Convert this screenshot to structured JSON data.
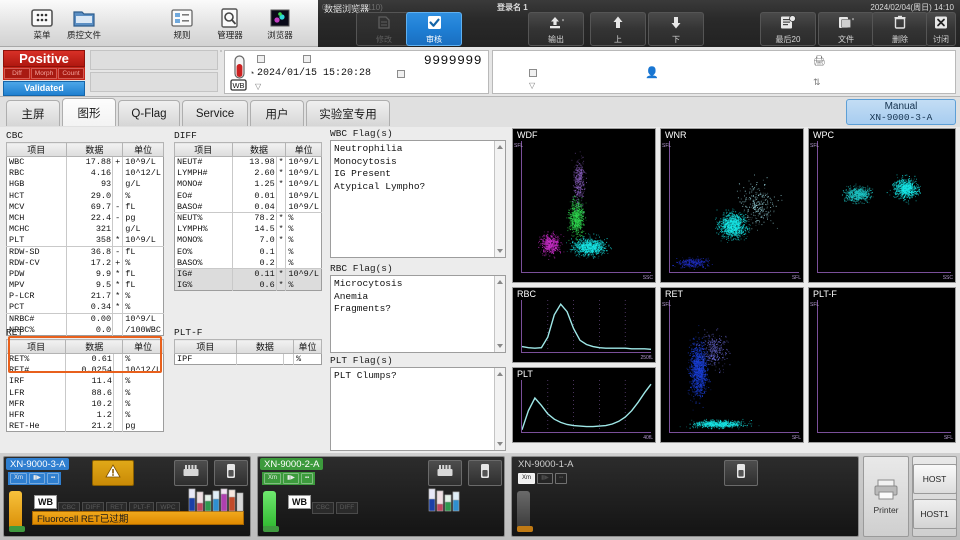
{
  "toolbar": {
    "items": [
      {
        "label": "菜单",
        "icon": "menu-grid-icon"
      },
      {
        "label": "质控文件",
        "icon": "qc-file-icon"
      },
      {
        "label": "规则",
        "icon": "rules-icon"
      },
      {
        "label": "管理器",
        "icon": "manager-icon"
      },
      {
        "label": "浏览器",
        "icon": "browser-icon"
      }
    ],
    "window_title": "数据浏览器",
    "dark_buttons": [
      {
        "label": "修改",
        "icon": "edit-icon",
        "state": "disabled"
      },
      {
        "label": "审核",
        "icon": "check-icon",
        "state": "active"
      },
      {
        "label": "输出",
        "icon": "output-icon",
        "state": "normal"
      },
      {
        "label": "上",
        "icon": "arrow-up-icon",
        "state": "normal"
      },
      {
        "label": "下",
        "icon": "arrow-down-icon",
        "state": "normal"
      },
      {
        "label": "最后20",
        "icon": "last20-icon",
        "state": "normal"
      },
      {
        "label": "文件",
        "icon": "file-icon",
        "state": "normal"
      },
      {
        "label": "删除",
        "icon": "trash-icon",
        "state": "normal"
      },
      {
        "label": "讨闭",
        "icon": "close-x-icon",
        "state": "normal"
      }
    ]
  },
  "status": {
    "left": "00-22 (Build 110)",
    "user": "登录名 1",
    "datetime": "2024/02/04(周日) 14:10"
  },
  "sample": {
    "positive_label": "Positive",
    "positive_tags": [
      "Diff",
      "Morph",
      "Count"
    ],
    "validated_label": "Validated",
    "sample_id": "9999999",
    "datetime": "2024/01/15  15:20:28",
    "tube_label": "WB"
  },
  "tabs": [
    {
      "label": "主屏",
      "selected": false
    },
    {
      "label": "图形",
      "selected": true
    },
    {
      "label": "Q-Flag",
      "selected": false
    },
    {
      "label": "Service",
      "selected": false
    },
    {
      "label": "用户",
      "selected": false
    },
    {
      "label": "实验室专用",
      "selected": false
    }
  ],
  "manual": {
    "line1": "Manual",
    "line2": "XN-9000-3-A"
  },
  "tables": {
    "headers": {
      "item": "项目",
      "data": "数据",
      "unit": "单位"
    },
    "cbc": {
      "title": "CBC",
      "rows": [
        {
          "name": "WBC",
          "value": "17.88",
          "flag": "+",
          "unit": "10^9/L"
        },
        {
          "name": "RBC",
          "value": "4.16",
          "flag": "",
          "unit": "10^12/L"
        },
        {
          "name": "HGB",
          "value": "93",
          "flag": "",
          "unit": "g/L"
        },
        {
          "name": "HCT",
          "value": "29.0",
          "flag": "",
          "unit": "%"
        },
        {
          "name": "MCV",
          "value": "69.7",
          "flag": "-",
          "unit": "fL"
        },
        {
          "name": "MCH",
          "value": "22.4",
          "flag": "-",
          "unit": "pg"
        },
        {
          "name": "MCHC",
          "value": "321",
          "flag": "",
          "unit": "g/L"
        },
        {
          "name": "PLT",
          "value": "358",
          "flag": "*",
          "unit": "10^9/L",
          "groupend": true
        },
        {
          "name": "RDW-SD",
          "value": "36.8",
          "flag": "-",
          "unit": "fL"
        },
        {
          "name": "RDW-CV",
          "value": "17.2",
          "flag": "+",
          "unit": "%"
        },
        {
          "name": "PDW",
          "value": "9.9",
          "flag": "*",
          "unit": "fL"
        },
        {
          "name": "MPV",
          "value": "9.5",
          "flag": "*",
          "unit": "fL"
        },
        {
          "name": "P-LCR",
          "value": "21.7",
          "flag": "*",
          "unit": "%"
        },
        {
          "name": "PCT",
          "value": "0.34",
          "flag": "*",
          "unit": "%",
          "groupend": true
        },
        {
          "name": "NRBC#",
          "value": "0.00",
          "flag": "",
          "unit": "10^9/L"
        },
        {
          "name": "NRBC%",
          "value": "0.0",
          "flag": "",
          "unit": "/100WBC"
        }
      ]
    },
    "ret": {
      "title": "RET",
      "rows": [
        {
          "name": "RET%",
          "value": "0.61",
          "flag": "",
          "unit": "%"
        },
        {
          "name": "RET#",
          "value": "0.0254",
          "flag": "",
          "unit": "10^12/L"
        },
        {
          "name": "IRF",
          "value": "11.4",
          "flag": "",
          "unit": "%"
        },
        {
          "name": "LFR",
          "value": "88.6",
          "flag": "",
          "unit": "%"
        },
        {
          "name": "MFR",
          "value": "10.2",
          "flag": "",
          "unit": "%"
        },
        {
          "name": "HFR",
          "value": "1.2",
          "flag": "",
          "unit": "%"
        },
        {
          "name": "RET-He",
          "value": "21.2",
          "flag": "",
          "unit": "pg"
        }
      ]
    },
    "diff": {
      "title": "DIFF",
      "rows": [
        {
          "name": "NEUT#",
          "value": "13.98",
          "flag": "*",
          "unit": "10^9/L"
        },
        {
          "name": "LYMPH#",
          "value": "2.60",
          "flag": "*",
          "unit": "10^9/L"
        },
        {
          "name": "MONO#",
          "value": "1.25",
          "flag": "*",
          "unit": "10^9/L"
        },
        {
          "name": "EO#",
          "value": "0.01",
          "flag": "",
          "unit": "10^9/L"
        },
        {
          "name": "BASO#",
          "value": "0.04",
          "flag": "",
          "unit": "10^9/L",
          "groupend": true
        },
        {
          "name": "NEUT%",
          "value": "78.2",
          "flag": "*",
          "unit": "%"
        },
        {
          "name": "LYMPH%",
          "value": "14.5",
          "flag": "*",
          "unit": "%"
        },
        {
          "name": "MONO%",
          "value": "7.0",
          "flag": "*",
          "unit": "%"
        },
        {
          "name": "EO%",
          "value": "0.1",
          "flag": "",
          "unit": "%"
        },
        {
          "name": "BASO%",
          "value": "0.2",
          "flag": "",
          "unit": "%",
          "groupend": true
        },
        {
          "name": "IG#",
          "value": "0.11",
          "flag": "*",
          "unit": "10^9/L",
          "shade": true
        },
        {
          "name": "IG%",
          "value": "0.6",
          "flag": "*",
          "unit": "%",
          "shade": true
        }
      ]
    },
    "pltf": {
      "title": "PLT-F",
      "rows": [
        {
          "name": "IPF",
          "value": "",
          "flag": "",
          "unit": "%"
        }
      ]
    }
  },
  "flags": {
    "wbc": {
      "title": "WBC Flag(s)",
      "items": [
        "Neutrophilia",
        "Monocytosis",
        "IG Present",
        "Atypical Lympho?"
      ]
    },
    "rbc": {
      "title": "RBC Flag(s)",
      "items": [
        "Microcytosis",
        "Anemia",
        "Fragments?"
      ]
    },
    "plt": {
      "title": "PLT Flag(s)",
      "items": [
        "PLT Clumps?"
      ]
    }
  },
  "graphs": [
    {
      "title": "WDF",
      "ylabel": "SFL",
      "xlabel": "SSC",
      "type": "scatter"
    },
    {
      "title": "WNR",
      "ylabel": "SFL",
      "xlabel": "SFL",
      "type": "scatter"
    },
    {
      "title": "WPC",
      "ylabel": "SFL",
      "xlabel": "SSC",
      "type": "scatter"
    },
    {
      "title": "RBC",
      "ylabel": "",
      "xlabel": "250fL",
      "type": "histogram"
    },
    {
      "title": "PLT",
      "ylabel": "",
      "xlabel": "40fL",
      "type": "histogram"
    },
    {
      "title": "RET",
      "ylabel": "SFL",
      "xlabel": "SFL",
      "type": "scatter"
    },
    {
      "title": "PLT-F",
      "ylabel": "SFL",
      "xlabel": "SFL",
      "type": "scatter"
    }
  ],
  "analyzers": [
    {
      "name": "XN-9000-3-A",
      "name_color": "#2f7fd0",
      "chips": [
        "Xm",
        "▮▶",
        "▪▪"
      ],
      "tube_color": "#f0a81c",
      "led_color": "#3f9a3f",
      "wb_label": "WB",
      "tests": [
        "CBC",
        "DIFF",
        "RET",
        "PLT-F",
        "WPC"
      ],
      "error": "Fluorocell RET已过期",
      "warning": true,
      "rack_icon": true,
      "tube_icon": true
    },
    {
      "name": "XN-9000-2-A",
      "name_color": "#3c9a3c",
      "chips": [
        "Xm",
        "▮▶",
        "▪▪"
      ],
      "tube_color": "#4fd04f",
      "led_color": "#3f9a3f",
      "wb_label": "WB",
      "tests": [
        "CBC",
        "DIFF"
      ],
      "error": "",
      "warning": false,
      "rack_icon": true,
      "tube_icon": true
    },
    {
      "name": "XN-9000-1-A",
      "name_color": "#555555",
      "chips": [
        "Xm",
        "▮▶",
        "▪▪"
      ],
      "tube_color": "#5a5a5a",
      "led_color": "#c07a14",
      "wb_label": "",
      "tests": [],
      "error": "",
      "warning": false,
      "rack_icon": false,
      "tube_icon": true
    }
  ],
  "right_panels": {
    "printer": "Printer",
    "host": "HOST",
    "host1": "HOST1"
  },
  "chart_data": [
    {
      "type": "scatter",
      "title": "WDF",
      "xlabel": "SSC",
      "ylabel": "SFL",
      "clusters": [
        {
          "name": "lymphocytes",
          "color": "#18e8e8",
          "cx": 0.52,
          "cy": 0.8,
          "rx": 0.13,
          "ry": 0.07,
          "n": 900
        },
        {
          "name": "monocytes",
          "color": "#cf2fcf",
          "cx": 0.22,
          "cy": 0.78,
          "rx": 0.08,
          "ry": 0.08,
          "n": 500
        },
        {
          "name": "neutrophils",
          "color": "#2fd84f",
          "cx": 0.42,
          "cy": 0.58,
          "rx": 0.06,
          "ry": 0.14,
          "n": 700
        },
        {
          "name": "immature",
          "color": "#8a5fbf",
          "cx": 0.44,
          "cy": 0.3,
          "rx": 0.05,
          "ry": 0.18,
          "n": 350
        }
      ]
    },
    {
      "type": "scatter",
      "title": "WNR",
      "xlabel": "SFL",
      "ylabel": "SFL",
      "clusters": [
        {
          "name": "wbc",
          "color": "#18e8e8",
          "cx": 0.48,
          "cy": 0.64,
          "rx": 0.11,
          "ry": 0.1,
          "n": 1100
        },
        {
          "name": "scatter-tail",
          "color": "#9fdfe8",
          "cx": 0.68,
          "cy": 0.48,
          "rx": 0.15,
          "ry": 0.18,
          "n": 260
        },
        {
          "name": "debris",
          "color": "#2030c8",
          "cx": 0.18,
          "cy": 0.92,
          "rx": 0.13,
          "ry": 0.04,
          "n": 300
        }
      ]
    },
    {
      "type": "scatter",
      "title": "WPC",
      "xlabel": "SSC",
      "ylabel": "SFL",
      "clusters": [
        {
          "name": "cluster-right",
          "color": "#18e8e8",
          "cx": 0.66,
          "cy": 0.36,
          "rx": 0.1,
          "ry": 0.08,
          "n": 800
        },
        {
          "name": "cluster-left",
          "color": "#1ec8c8",
          "cx": 0.3,
          "cy": 0.4,
          "rx": 0.1,
          "ry": 0.06,
          "n": 600
        }
      ]
    },
    {
      "type": "line",
      "title": "RBC",
      "xlabel": "250fL",
      "x": [
        0,
        5,
        10,
        15,
        20,
        25,
        30,
        35,
        40,
        45,
        50,
        55,
        60,
        65,
        70,
        75,
        80,
        85,
        90,
        95,
        100
      ],
      "values": [
        12,
        10,
        9,
        10,
        30,
        72,
        92,
        78,
        46,
        24,
        16,
        12,
        10,
        9,
        9,
        9,
        9,
        8,
        8,
        8,
        7
      ]
    },
    {
      "type": "line",
      "title": "PLT",
      "xlabel": "40fL",
      "x": [
        0,
        5,
        10,
        15,
        20,
        25,
        30,
        35,
        40,
        45,
        50,
        55,
        60,
        65,
        70,
        75,
        80,
        85,
        90,
        95,
        100
      ],
      "values": [
        6,
        42,
        66,
        52,
        36,
        26,
        20,
        16,
        14,
        13,
        12,
        12,
        13,
        14,
        17,
        22,
        30,
        42,
        58,
        76,
        92
      ]
    },
    {
      "type": "scatter",
      "title": "RET",
      "xlabel": "SFL",
      "ylabel": "SFL",
      "clusters": [
        {
          "name": "rbc-population",
          "color": "#1a3fd8",
          "cx": 0.22,
          "cy": 0.52,
          "rx": 0.07,
          "ry": 0.22,
          "n": 1200
        },
        {
          "name": "retic",
          "color": "#6a6ad8",
          "cx": 0.34,
          "cy": 0.38,
          "rx": 0.1,
          "ry": 0.14,
          "n": 300
        },
        {
          "name": "platelets",
          "color": "#18e8e8",
          "cx": 0.38,
          "cy": 0.93,
          "rx": 0.22,
          "ry": 0.03,
          "n": 700
        }
      ]
    },
    {
      "type": "scatter",
      "title": "PLT-F",
      "xlabel": "SFL",
      "ylabel": "SFL",
      "clusters": []
    }
  ]
}
